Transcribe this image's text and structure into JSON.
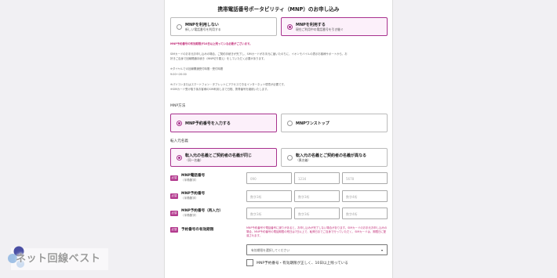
{
  "title": "携帯電話番号ポータビリティ（MNP）のお申し込み",
  "mnp_choice": {
    "no": {
      "main": "MNPを利用しない",
      "sub": "新しい電話番号を利用する"
    },
    "yes": {
      "main": "MNPを利用する",
      "sub": "現在ご利用中の電話番号を引き継ぐ"
    }
  },
  "notes": {
    "pink": "MNP予約番号の有効期限が10日以上残っている必要がございます。",
    "l1": "SIMカードのお手元お申し込みの場合、ご契約手続きが完了し、SIMカードがお手元に届いたのちに、イオンモバイルの表示お客様サポートから、お",
    "l2": "好きご自身で回線開通手続き（MNP切り替え）をしていただく必要があります。",
    "l3": "※ダイヤルでの回線開通受付時間・受付時間",
    "l4": "9:00〜20:00",
    "l5": "※パソコンまたはスマートフォン・タブレットにアクセスできるインターネット環境が必要です。",
    "l6": "※SIMカード受け取り後お客様のSIM利用しまで日程、携帯番号を継続いたします。"
  },
  "method": {
    "label": "MNP方法",
    "a": "MNP予約番号を入力する",
    "b": "MNPワンストップ"
  },
  "transfer": {
    "label": "転入元名義",
    "same": {
      "main": "転入元の名義とご契約者の名義が同じ",
      "sub": "（同一名義）"
    },
    "diff": {
      "main": "転入元の名義とご契約者の名義が異なる",
      "sub": "（異名義）"
    }
  },
  "rows": {
    "badge": "必須",
    "phone": {
      "label": "MNP電話番号",
      "sub": "（半角数字）",
      "ph1": "090",
      "ph2": "1234",
      "ph3": "5678"
    },
    "reserve": {
      "label": "MNP予約番号",
      "sub": "（半角数字）",
      "ph1": "数字3桁",
      "ph2": "数字3桁",
      "ph3": "数字4桁"
    },
    "reserve2": {
      "label": "MNP予約番号（再入力）",
      "sub": "（半角数字）",
      "ph1": "数字3桁",
      "ph2": "数字3桁",
      "ph3": "数字4桁"
    },
    "expiry": {
      "label": "予約番号の有効期限"
    }
  },
  "expiry_warn": "MNP予約番号や電話番号に誤りがあると、お申し込みが完了しない場合があります。SIMカードのお手元お申し込みの場合、MNP予約番号の電話期限の残日は7日以上で、転帰日までご自身で行っていただく、SIMカードは、期限日に配達されます。",
  "select_placeholder": "有効期限を選択してください",
  "checkbox_label": "MNP予約番号・有効期限が正しく、10日以上残っている",
  "logo_text": "ネット回線ベスト",
  "colors": {
    "accent": "#a8328e",
    "badge": "#b33a8e",
    "warn": "#c2307a"
  }
}
